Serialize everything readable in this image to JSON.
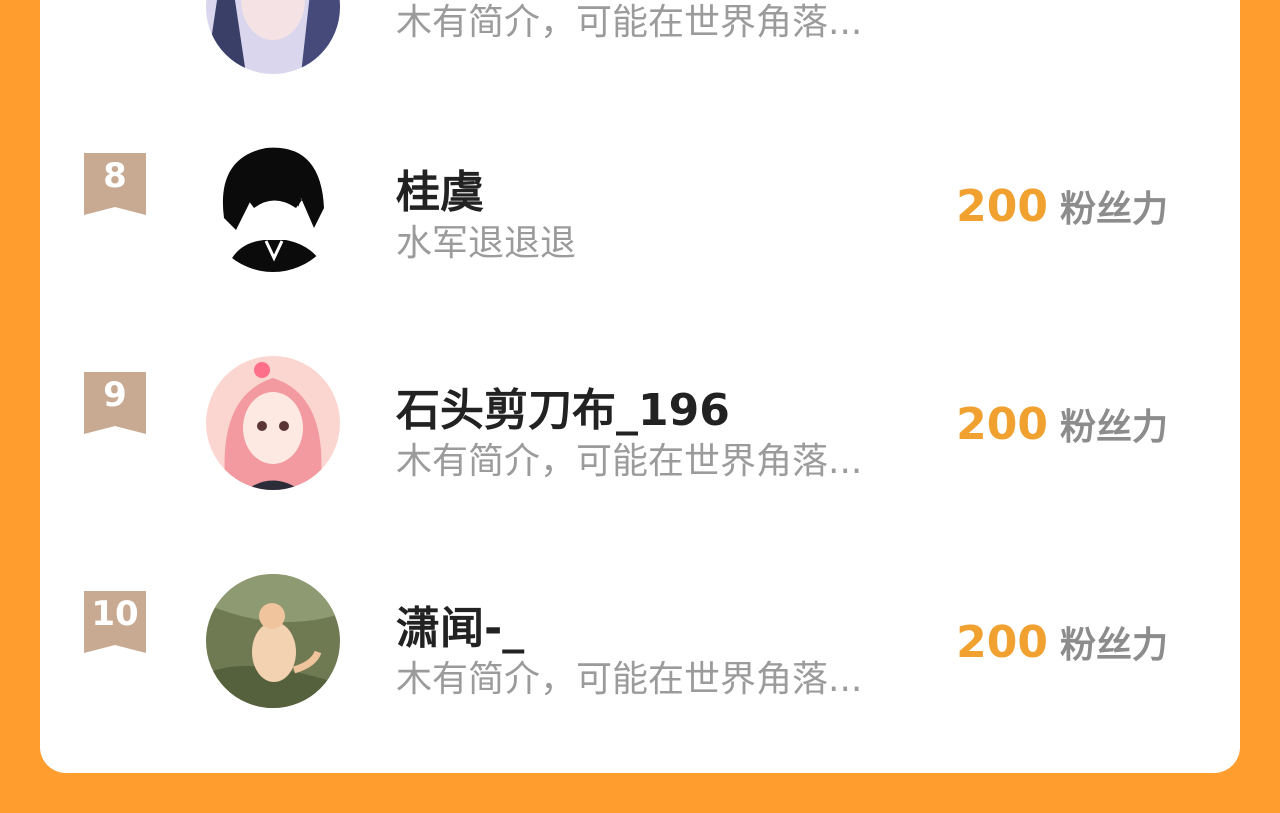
{
  "rows": [
    {
      "rank": "",
      "name": "",
      "bio": "木有简介，可能在世界角落...",
      "fans_value": "",
      "fans_unit": ""
    },
    {
      "rank": "8",
      "name": "桂虞",
      "bio": "水军退退退",
      "fans_value": "200",
      "fans_unit": "粉丝力"
    },
    {
      "rank": "9",
      "name": "石头剪刀布_196",
      "bio": "木有简介，可能在世界角落...",
      "fans_value": "200",
      "fans_unit": "粉丝力"
    },
    {
      "rank": "10",
      "name": "潇闻-_",
      "bio": "木有简介，可能在世界角落...",
      "fans_value": "200",
      "fans_unit": "粉丝力"
    }
  ],
  "colors": {
    "background": "#ff9d2e",
    "panel": "#ffffff",
    "fans_value": "#f0a12f",
    "badge": "#c8a991",
    "name": "#222222",
    "bio": "#9b9b9b"
  },
  "icons": {
    "rank_badge": "ribbon-flag-icon"
  }
}
